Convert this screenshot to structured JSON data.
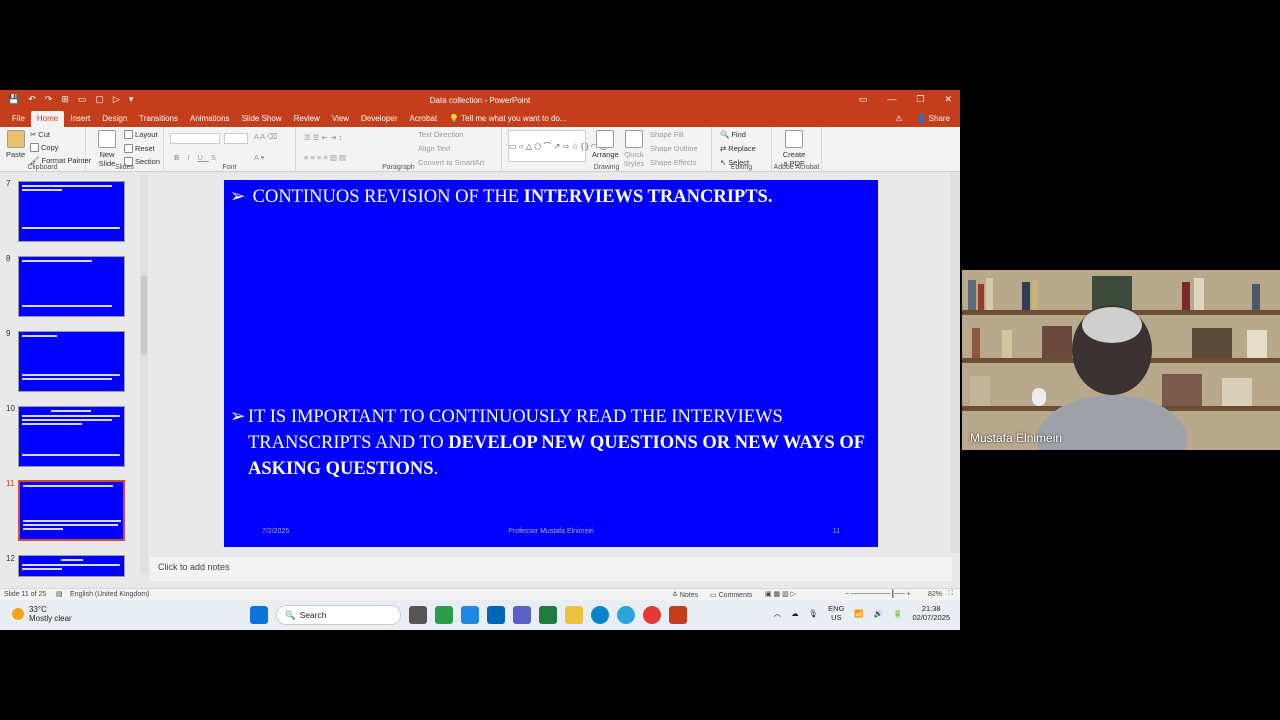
{
  "window": {
    "title": "Data collection - PowerPoint",
    "quick_access": [
      "💾",
      "↶",
      "↷",
      "⊞",
      "▭",
      "▢",
      "▷",
      "▾"
    ],
    "controls": [
      "▭",
      "—",
      "❐",
      "✕"
    ]
  },
  "tabs": [
    "File",
    "Home",
    "Insert",
    "Design",
    "Transitions",
    "Animations",
    "Slide Show",
    "Review",
    "View",
    "Developer",
    "Acrobat"
  ],
  "tell_me": "Tell me what you want to do...",
  "share_label": "Share",
  "ribbon": {
    "clipboard": {
      "paste": "Paste",
      "cut": "Cut",
      "copy": "Copy",
      "format_painter": "Format Painter",
      "label": "Clipboard"
    },
    "slides": {
      "new_slide": "New Slide",
      "layout": "Layout",
      "reset": "Reset",
      "section": "Section",
      "label": "Slides"
    },
    "font": {
      "label": "Font"
    },
    "paragraph": {
      "text_direction": "Text Direction",
      "align_text": "Align Text",
      "convert": "Convert to SmartArt",
      "label": "Paragraph"
    },
    "drawing": {
      "arrange": "Arrange",
      "quick_styles": "Quick Styles",
      "shape_fill": "Shape Fill",
      "shape_outline": "Shape Outline",
      "shape_effects": "Shape Effects",
      "label": "Drawing"
    },
    "editing": {
      "find": "Find",
      "replace": "Replace",
      "select": "Select",
      "label": "Editing"
    },
    "acrobat": {
      "create_pdf": "Create a PDF",
      "label": "Adobe Acrobat"
    }
  },
  "thumbnails": [
    {
      "num": "7"
    },
    {
      "num": "8"
    },
    {
      "num": "9"
    },
    {
      "num": "10"
    },
    {
      "num": "11"
    },
    {
      "num": "12"
    }
  ],
  "slide": {
    "bullet1_plain": "CONTINUOS REVISION OF THE ",
    "bullet1_bold": "INTERVIEWS TRANCRIPTS.",
    "bullet2_plain": "IT IS IMPORTANT TO CONTINUOUSLY READ THE INTERVIEWS TRANSCRIPTS AND TO ",
    "bullet2_bold": "DEVELOP NEW QUESTIONS OR NEW WAYS OF ASKING QUESTIONS",
    "bullet2_end": ".",
    "footer_date": "7/2/2025",
    "footer_center": "Professor Mustafa Elnimeiri",
    "footer_num": "11"
  },
  "notes_placeholder": "Click to add notes",
  "status": {
    "slide_info": "Slide 11 of 25",
    "language": "English (United Kingdom)",
    "notes": "Notes",
    "comments": "Comments",
    "zoom": "82%"
  },
  "taskbar": {
    "temp": "33°C",
    "weather": "Mostly clear",
    "search": "Search",
    "lang1": "ENG",
    "lang2": "US",
    "time": "21:38",
    "date": "02/07/2025"
  },
  "video": {
    "name": "Mustafa Elnimeiri"
  }
}
